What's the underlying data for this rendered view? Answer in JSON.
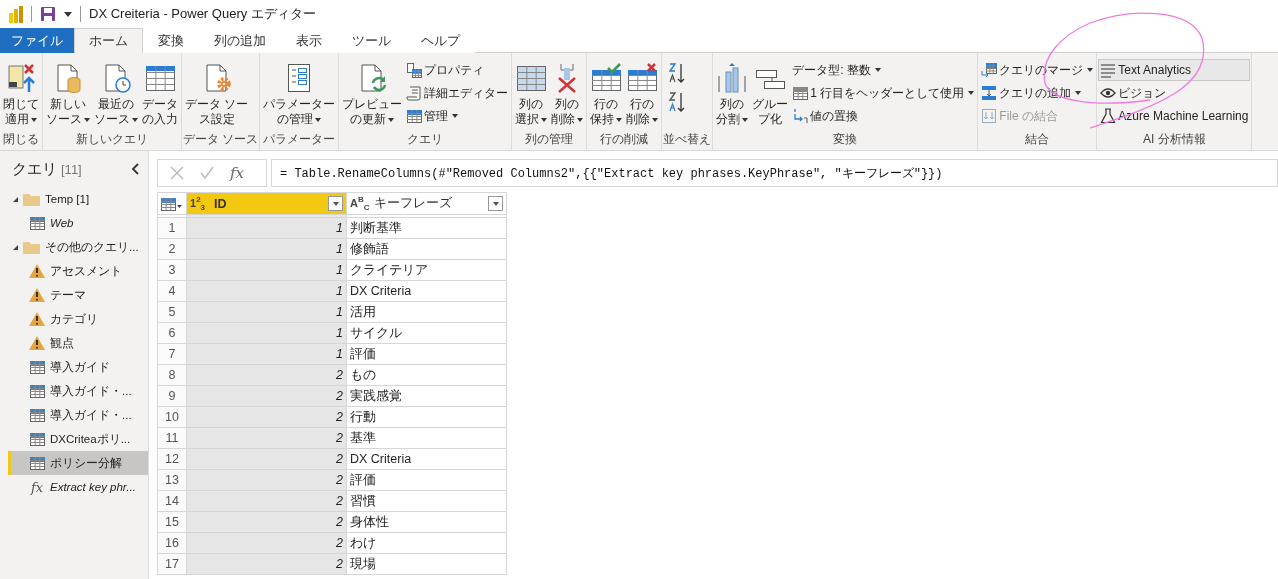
{
  "title_bar": {
    "title": "DX Creiteria - Power Query エディター"
  },
  "tabs": [
    {
      "label": "ファイル",
      "kind": "file",
      "selected": false
    },
    {
      "label": "ホーム",
      "kind": "tab",
      "selected": true
    },
    {
      "label": "変換",
      "kind": "tab",
      "selected": false
    },
    {
      "label": "列の追加",
      "kind": "tab",
      "selected": false
    },
    {
      "label": "表示",
      "kind": "tab",
      "selected": false
    },
    {
      "label": "ツール",
      "kind": "tab",
      "selected": false
    },
    {
      "label": "ヘルプ",
      "kind": "tab",
      "selected": false
    }
  ],
  "ribbon": {
    "groups": [
      {
        "label": "閉じる",
        "items": [
          {
            "kind": "large",
            "lines": [
              "閉じて",
              "適用"
            ],
            "dropdown": true
          }
        ]
      },
      {
        "label": "新しいクエリ",
        "items": [
          {
            "kind": "large",
            "lines": [
              "新しい",
              "ソース"
            ],
            "dropdown": true
          },
          {
            "kind": "large",
            "lines": [
              "最近の",
              "ソース"
            ],
            "dropdown": true
          },
          {
            "kind": "large",
            "lines": [
              "データ",
              "の入力"
            ],
            "dropdown": false
          }
        ]
      },
      {
        "label": "データ ソース",
        "items": [
          {
            "kind": "large",
            "lines": [
              "データ ソー",
              "ス設定"
            ],
            "dropdown": false
          }
        ]
      },
      {
        "label": "パラメーター",
        "items": [
          {
            "kind": "large",
            "lines": [
              "パラメーター",
              "の管理"
            ],
            "dropdown": true
          }
        ]
      },
      {
        "label": "クエリ",
        "items": [
          {
            "kind": "large",
            "lines": [
              "プレビュー",
              "の更新"
            ],
            "dropdown": true
          },
          {
            "kind": "small",
            "label": "プロパティ",
            "dropdown": false
          },
          {
            "kind": "small",
            "label": "詳細エディター",
            "dropdown": false
          },
          {
            "kind": "small",
            "label": "管理",
            "dropdown": true
          }
        ]
      },
      {
        "label": "列の管理",
        "items": [
          {
            "kind": "large",
            "lines": [
              "列の",
              "選択"
            ],
            "dropdown": true
          },
          {
            "kind": "large",
            "lines": [
              "列の",
              "削除"
            ],
            "dropdown": true
          }
        ]
      },
      {
        "label": "行の削減",
        "items": [
          {
            "kind": "large",
            "lines": [
              "行の",
              "保持"
            ],
            "dropdown": true
          },
          {
            "kind": "large",
            "lines": [
              "行の",
              "削除"
            ],
            "dropdown": true
          }
        ]
      },
      {
        "label": "並べ替え",
        "items": [
          {
            "kind": "icon"
          },
          {
            "kind": "icon"
          }
        ]
      },
      {
        "label": "変換",
        "items": [
          {
            "kind": "large",
            "lines": [
              "列の",
              "分割"
            ],
            "dropdown": true
          },
          {
            "kind": "large",
            "lines": [
              "グルー",
              "プ化"
            ],
            "dropdown": false
          },
          {
            "kind": "text",
            "label": "データ型: 整数",
            "dropdown": true
          },
          {
            "kind": "small",
            "label": "1 行目をヘッダーとして使用",
            "dropdown": true
          },
          {
            "kind": "small",
            "label": "値の置換",
            "dropdown": false
          }
        ]
      },
      {
        "label": "結合",
        "items": [
          {
            "kind": "small",
            "label": "クエリのマージ",
            "dropdown": true
          },
          {
            "kind": "small",
            "label": "クエリの追加",
            "dropdown": true
          },
          {
            "kind": "small",
            "label": "File の結合",
            "dropdown": false,
            "disabled": true
          }
        ]
      },
      {
        "label": "AI 分析情報",
        "items": [
          {
            "kind": "small",
            "label": "Text Analytics",
            "dropdown": false,
            "highlighted": true
          },
          {
            "kind": "small",
            "label": "ビジョン",
            "dropdown": false
          },
          {
            "kind": "small",
            "label": "Azure Machine Learning",
            "dropdown": false
          }
        ]
      }
    ]
  },
  "annotations": [
    {
      "kind": "freehand-loop"
    }
  ],
  "sidebar": {
    "title": "クエリ",
    "count": "[11]",
    "items": [
      {
        "kind": "folder",
        "label": "Temp [1]",
        "expanded": true,
        "children": [
          {
            "kind": "table",
            "label": "Web",
            "connection_only": true,
            "selected": false
          }
        ]
      },
      {
        "kind": "folder",
        "label": "その他のクエリ...",
        "expanded": true,
        "children": [
          {
            "kind": "warning",
            "label": "アセスメント",
            "connection_only": false,
            "selected": false
          },
          {
            "kind": "warning",
            "label": "テーマ",
            "connection_only": false,
            "selected": false
          },
          {
            "kind": "warning",
            "label": "カテゴリ",
            "connection_only": false,
            "selected": false
          },
          {
            "kind": "warning",
            "label": "観点",
            "connection_only": false,
            "selected": false
          },
          {
            "kind": "table",
            "label": "導入ガイド",
            "connection_only": false,
            "selected": false
          },
          {
            "kind": "table",
            "label": "導入ガイド・...",
            "connection_only": false,
            "selected": false
          },
          {
            "kind": "table",
            "label": "導入ガイド・...",
            "connection_only": false,
            "selected": false
          },
          {
            "kind": "table",
            "label": "DXCriteaポリ...",
            "connection_only": false,
            "selected": false
          },
          {
            "kind": "table",
            "label": "ポリシー分解",
            "connection_only": false,
            "selected": true
          },
          {
            "kind": "function",
            "symbol": "fx",
            "label": "Extract key phr...",
            "connection_only": true,
            "selected": false
          }
        ]
      }
    ]
  },
  "formula_bar": {
    "symbol": "fx",
    "formula": "= Table.RenameColumns(#\"Removed Columns2\",{{\"Extract key phrases.KeyPhrase\", \"キーフレーズ\"}})"
  },
  "table": {
    "columns": [
      {
        "name": "ID",
        "type_label": "1$^{2}$$_{3}$",
        "kind": "number",
        "selected": true
      },
      {
        "name": "キーフレーズ",
        "type_label": "A$^{B}$$_{C}$",
        "kind": "text",
        "selected": false
      }
    ],
    "rows": [
      {
        "row_number": "1",
        "cells": [
          "1",
          "判断基準"
        ]
      },
      {
        "row_number": "2",
        "cells": [
          "1",
          "修飾語"
        ]
      },
      {
        "row_number": "3",
        "cells": [
          "1",
          "クライテリア"
        ]
      },
      {
        "row_number": "4",
        "cells": [
          "1",
          "DX Criteria"
        ]
      },
      {
        "row_number": "5",
        "cells": [
          "1",
          "活用"
        ]
      },
      {
        "row_number": "6",
        "cells": [
          "1",
          "サイクル"
        ]
      },
      {
        "row_number": "7",
        "cells": [
          "1",
          "評価"
        ]
      },
      {
        "row_number": "8",
        "cells": [
          "2",
          "もの"
        ]
      },
      {
        "row_number": "9",
        "cells": [
          "2",
          "実践感覚"
        ]
      },
      {
        "row_number": "10",
        "cells": [
          "2",
          "行動"
        ]
      },
      {
        "row_number": "11",
        "cells": [
          "2",
          "基準"
        ]
      },
      {
        "row_number": "12",
        "cells": [
          "2",
          "DX Criteria"
        ]
      },
      {
        "row_number": "13",
        "cells": [
          "2",
          "評価"
        ]
      },
      {
        "row_number": "14",
        "cells": [
          "2",
          "習慣"
        ]
      },
      {
        "row_number": "15",
        "cells": [
          "2",
          "身体性"
        ]
      },
      {
        "row_number": "16",
        "cells": [
          "2",
          "わけ"
        ]
      },
      {
        "row_number": "17",
        "cells": [
          "2",
          "現場"
        ]
      }
    ]
  }
}
